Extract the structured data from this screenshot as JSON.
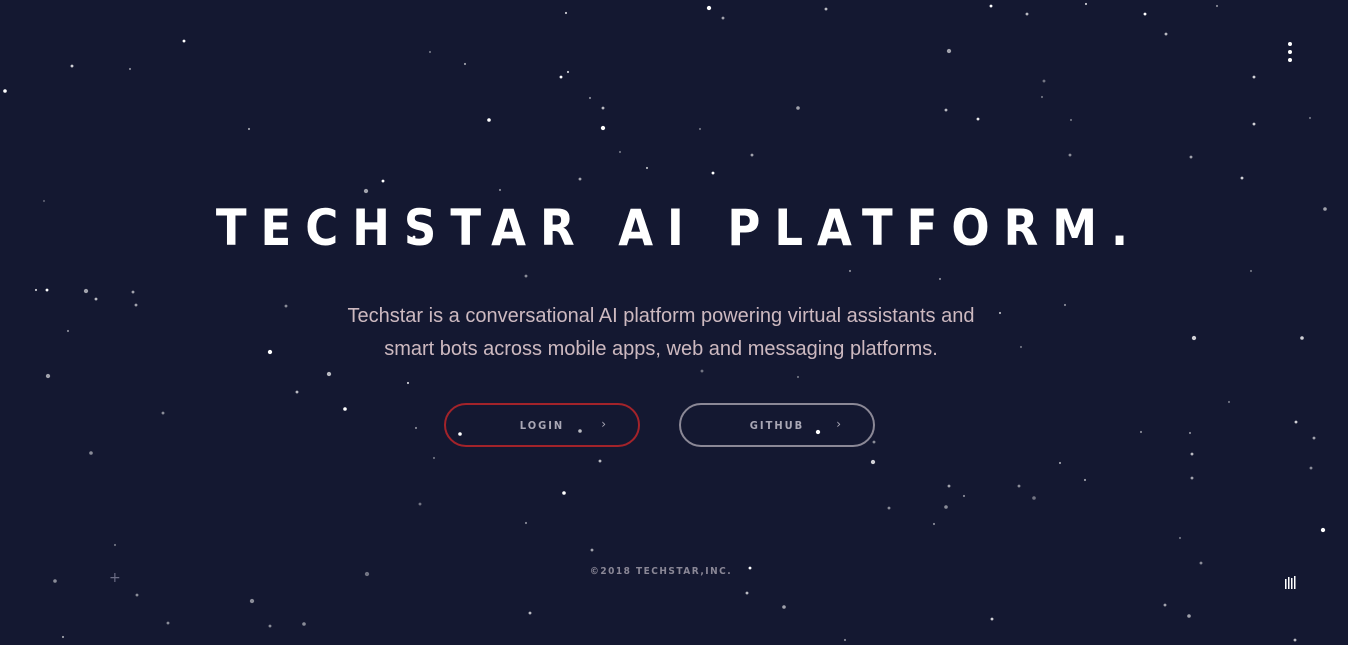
{
  "hero": {
    "title": "TECHSTAR AI PLATFORM.",
    "description": "Techstar is a conversational AI platform powering virtual assistants and smart bots across mobile apps, web and messaging platforms."
  },
  "buttons": {
    "login_label": "LOGIN",
    "github_label": "GITHUB",
    "chevron": "›"
  },
  "footer": {
    "copyright": "©2018 TECHSTAR,INC."
  },
  "decor": {
    "plus": "+"
  },
  "colors": {
    "background": "#141831",
    "title": "#ffffff",
    "description": "#cdb9c0",
    "login_border": "#a3232a",
    "github_border": "#8b8896",
    "muted_text": "#a9a7b5"
  },
  "icons": {
    "menu": "vertical-dots-menu-icon",
    "sound": "sound-bars-icon",
    "plus": "plus-icon"
  }
}
